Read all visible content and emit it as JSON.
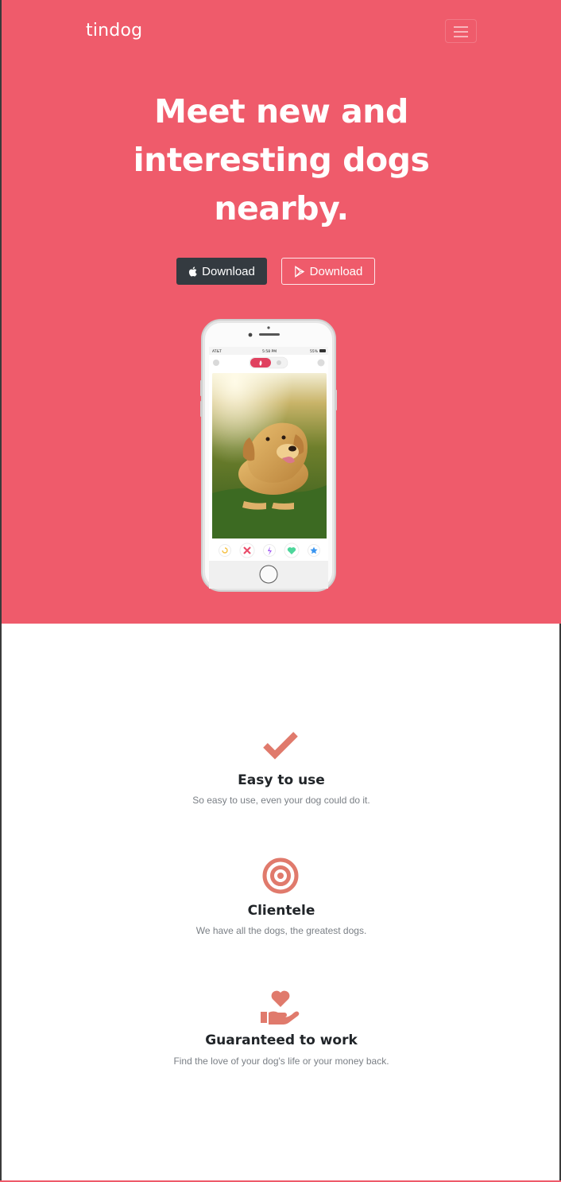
{
  "navbar": {
    "brand": "tindog",
    "menu_icon": "hamburger-menu-icon"
  },
  "hero": {
    "title": "Meet new and interesting dogs nearby.",
    "buttons": {
      "apple_label": "Download",
      "apple_icon": "apple-icon",
      "play_label": "Download",
      "play_icon": "google-play-icon"
    },
    "phone": {
      "carrier": "AT&T",
      "time": "5:58 PM",
      "battery": "55%",
      "action_icons": [
        "rewind-icon",
        "nope-x-icon",
        "boost-bolt-icon",
        "like-heart-icon",
        "super-like-star-icon"
      ]
    }
  },
  "features": [
    {
      "icon": "check-icon",
      "title": "Easy to use",
      "description": "So easy to use, even your dog could do it."
    },
    {
      "icon": "bullseye-icon",
      "title": "Clientele",
      "description": "We have all the dogs, the greatest dogs."
    },
    {
      "icon": "hand-holding-heart-icon",
      "title": "Guaranteed to work",
      "description": "Find the love of your dog's life or your money back."
    }
  ],
  "colors": {
    "hero_background": "#ef5b6b",
    "icon_accent": "#e07a6c",
    "apple_button": "#343a40",
    "heading_text": "#212529",
    "muted_text": "#7a7f85"
  }
}
